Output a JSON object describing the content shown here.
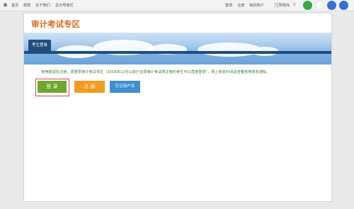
{
  "topbar": {
    "home_icon": "home-icon",
    "links": [
      "首页",
      "帮助",
      "关于我们",
      "显示导航栏"
    ],
    "right_links": [
      "登录",
      "注册",
      "我的账户"
    ],
    "cart_icon": "cart-icon",
    "cart_label": "购物车",
    "cart_count": "0"
  },
  "page": {
    "title": "审计考试专区",
    "tab_label": "考生登录",
    "notice": "使用前请先注册，再登录审计考试专区（2016年12月以前已在原审计考试网注册的考生可以直接登录），网上报名时间请查看各地报名通知。"
  },
  "buttons": {
    "login": "登 录",
    "register": "注 册",
    "forgot": "忘记用户名"
  },
  "colors": {
    "title": "#d86a1a",
    "tab": "#1f4d7f",
    "login": "#6ea82f",
    "register": "#f39b1e",
    "forgot": "#3f8fce"
  }
}
